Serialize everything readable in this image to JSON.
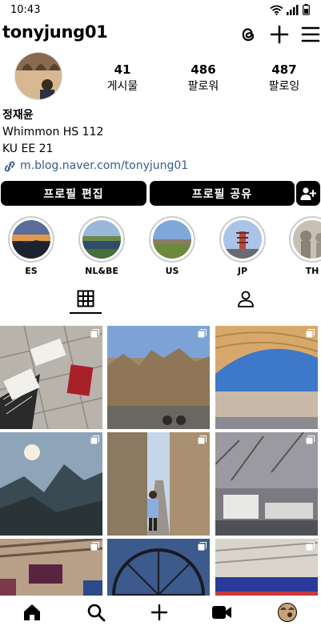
{
  "status": {
    "time": "10:43"
  },
  "header": {
    "username": "tonyjung01",
    "icons": [
      "threads-icon",
      "plus-icon",
      "menu-icon"
    ]
  },
  "profile": {
    "stats": [
      {
        "value": "41",
        "label": "게시물"
      },
      {
        "value": "486",
        "label": "팔로워"
      },
      {
        "value": "487",
        "label": "팔로잉"
      }
    ],
    "name": "정재윤",
    "bio_lines": [
      "Whimmon HS 112",
      "KU EE 21"
    ],
    "link": "m.blog.naver.com/tonyjung01"
  },
  "buttons": {
    "edit": "프로필 편집",
    "share": "프로필 공유"
  },
  "highlights": [
    {
      "label": "ES"
    },
    {
      "label": "NL&BE"
    },
    {
      "label": "US"
    },
    {
      "label": "JP"
    },
    {
      "label": "TH"
    }
  ],
  "tabs": [
    "grid-icon",
    "tagged-icon"
  ],
  "colors": {
    "link": "#385a8c",
    "button": "#000000"
  }
}
